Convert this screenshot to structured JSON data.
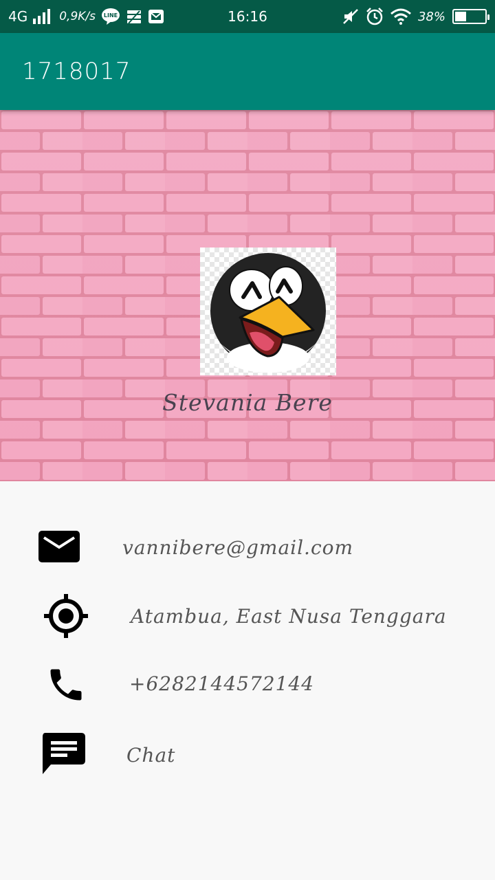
{
  "status_bar": {
    "network": "4G",
    "speed": "0,9K/s",
    "line_badge": "LINE",
    "time": "16:16",
    "battery_percent": "38%",
    "battery_level": 0.38,
    "icons": [
      "signal-icon",
      "line-icon",
      "data-saver-icon",
      "message-icon",
      "mute-icon",
      "alarm-icon",
      "wifi-icon",
      "battery-icon"
    ]
  },
  "app_bar": {
    "title": "1718017"
  },
  "profile": {
    "name": "Stevania Bere",
    "avatar_icon": "penguin-icon"
  },
  "contacts": [
    {
      "icon": "email-icon",
      "text": "vannibere@gmail.com"
    },
    {
      "icon": "location-icon",
      "text": "Atambua, East Nusa Tenggara"
    },
    {
      "icon": "phone-icon",
      "text": "+6282144572144"
    },
    {
      "icon": "chat-icon",
      "text": "Chat"
    }
  ],
  "colors": {
    "status_bar": "#055a47",
    "app_bar": "#008577",
    "brick": "#f2a7c0",
    "background": "#f8f8f8"
  }
}
